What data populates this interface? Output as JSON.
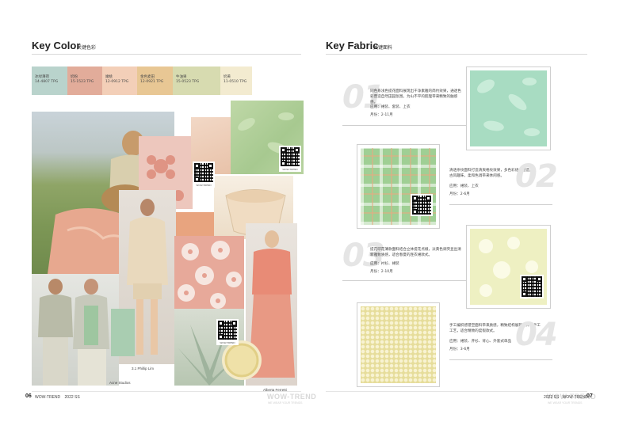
{
  "left_page": {
    "title": "Key Color",
    "subtitle": "关键色彩",
    "swatches": [
      {
        "name": "冰绿薄荷",
        "code": "14-4807 TPG",
        "color": "#b9d3cc"
      },
      {
        "name": "奶粉",
        "code": "15-1523 TPG",
        "color": "#e2ac9a"
      },
      {
        "name": "嫩桃",
        "code": "12-0912 TPG",
        "color": "#f3cfb8"
      },
      {
        "name": "金色麦田",
        "code": "12-0921 TPG",
        "color": "#e8c794"
      },
      {
        "name": "牛油果",
        "code": "15-0523 TPG",
        "color": "#d7dbb0"
      },
      {
        "name": "奶黄",
        "code": "11-0510 TPG",
        "color": "#f3ebd0"
      }
    ],
    "credits": {
      "phillip_lim": "3.1 Phillip Lim",
      "ferretti": "Alberta Ferretti",
      "acne": "Acne Studios"
    },
    "qr_caption": "WOW-TREND",
    "footer": {
      "page": "06",
      "brand": "WOW-TREND",
      "season": "2022 SS"
    },
    "watermark": "WOW-TREND",
    "watermark_sub": "WE WEAR YOUR TRENDS"
  },
  "right_page": {
    "title": "Key Fabric",
    "subtitle": "关键面料",
    "fabrics": [
      {
        "num": "01",
        "desc": "同色系浅色提花面料展现出干净素雅的简约效果，通透色彩营造自然田园氛围，为山不平的肌理带来精致的触感感。",
        "use": "应用：裙装、套装、上衣",
        "month": "月份：2-11月",
        "color": "#a8dcc2"
      },
      {
        "num": "02",
        "desc": "清透条纹面料打造清爽格纹效果，多色彩组合营造复古风趣味，柔和色调带来休闲感。",
        "use": "应用：裙装、上衣",
        "month": "月份：2-6月",
        "color": "#9fcf94"
      },
      {
        "num": "03",
        "desc": "提花印花薄款面料结合立体提花点缀，淡黄色调突显出清新雅致质感，适合春夏的连衣裙款式。",
        "use": "应用：衬衫、裙装",
        "month": "月份：2-10月",
        "color": "#eef0c2"
      },
      {
        "num": "04",
        "desc": "手工编织感镂空面料带来质感，精致结构展现立体的手工工艺，适合精致的度假款式。",
        "use": "应用：裙装、开衫、背心、外套式单品",
        "month": "月份：3-6月",
        "color": "#ece6ab"
      }
    ],
    "footer": {
      "page": "07",
      "brand": "WOW-TREND",
      "season": "2022 SS"
    },
    "watermark": "WOW-TREND",
    "watermark_sub": "WE WEAR YOUR TRENDS"
  }
}
